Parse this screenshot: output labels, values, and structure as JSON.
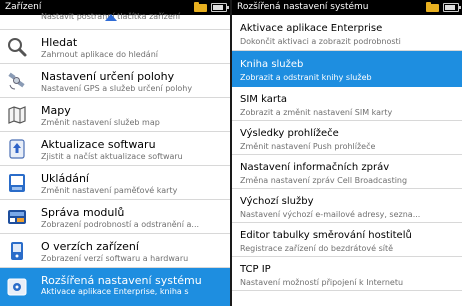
{
  "left_screen": {
    "status_title": "Zařízení",
    "partial_item_subtitle": "Nastavit postranní tlačítka zařízení",
    "items": [
      {
        "title": "Hledat",
        "subtitle": "Zahrnout aplikace do hledání",
        "icon": "search-icon"
      },
      {
        "title": "Nastavení určení polohy",
        "subtitle": "Nastavení GPS a služeb určení polohy",
        "icon": "satellite-icon"
      },
      {
        "title": "Mapy",
        "subtitle": "Změnit nastavení služeb map",
        "icon": "map-icon"
      },
      {
        "title": "Aktualizace softwaru",
        "subtitle": "Zjistit a načíst aktualizace softwaru",
        "icon": "software-update-icon"
      },
      {
        "title": "Ukládání",
        "subtitle": "Změnit nastavení paměťové karty",
        "icon": "memory-card-icon"
      },
      {
        "title": "Správa modulů",
        "subtitle": "Zobrazení podrobností a odstranění a...",
        "icon": "module-icon"
      },
      {
        "title": "O verzích zařízení",
        "subtitle": "Zobrazení verzí softwaru a hardwaru",
        "icon": "device-info-icon"
      },
      {
        "title": "Rozšířená nastavení systému",
        "subtitle": "Aktivace aplikace Enterprise, kniha s",
        "icon": "advanced-settings-icon",
        "selected": true
      }
    ]
  },
  "right_screen": {
    "status_title": "Rozšířená nastavení systému",
    "items": [
      {
        "title": "Aktivace aplikace Enterprise",
        "subtitle": "Dokončit aktivaci a zobrazit podrobnosti"
      },
      {
        "title": "Kniha služeb",
        "subtitle": "Zobrazit a odstranit knihy služeb",
        "selected": true
      },
      {
        "title": "SIM karta",
        "subtitle": "Zobrazit a změnit nastavení SIM karty"
      },
      {
        "title": "Výsledky prohlížeče",
        "subtitle": "Změnit nastavení Push prohlížeče"
      },
      {
        "title": "Nastavení informačních zpráv",
        "subtitle": "Změna nastavení zpráv Cell Broadcasting"
      },
      {
        "title": "Výchozí služby",
        "subtitle": "Nastavení výchozí e-mailové adresy, sezna..."
      },
      {
        "title": "Editor tabulky směrování hostitelů",
        "subtitle": "Registrace zařízení do bezdrátové sítě"
      },
      {
        "title": "TCP IP",
        "subtitle": "Nastavení možností připojení k Internetu"
      }
    ]
  },
  "colors": {
    "selection": "#1e8ee0",
    "status_bar": "#000000",
    "folder_icon": "#e8b020"
  }
}
